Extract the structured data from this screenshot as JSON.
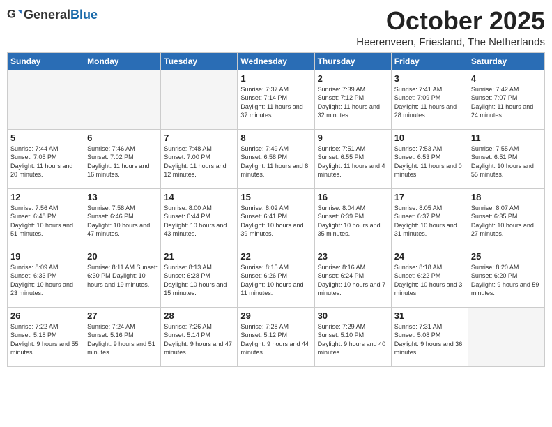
{
  "header": {
    "logo_general": "General",
    "logo_blue": "Blue",
    "title": "October 2025",
    "subtitle": "Heerenveen, Friesland, The Netherlands"
  },
  "columns": [
    "Sunday",
    "Monday",
    "Tuesday",
    "Wednesday",
    "Thursday",
    "Friday",
    "Saturday"
  ],
  "weeks": [
    [
      {
        "day": "",
        "info": ""
      },
      {
        "day": "",
        "info": ""
      },
      {
        "day": "",
        "info": ""
      },
      {
        "day": "1",
        "info": "Sunrise: 7:37 AM\nSunset: 7:14 PM\nDaylight: 11 hours\nand 37 minutes."
      },
      {
        "day": "2",
        "info": "Sunrise: 7:39 AM\nSunset: 7:12 PM\nDaylight: 11 hours\nand 32 minutes."
      },
      {
        "day": "3",
        "info": "Sunrise: 7:41 AM\nSunset: 7:09 PM\nDaylight: 11 hours\nand 28 minutes."
      },
      {
        "day": "4",
        "info": "Sunrise: 7:42 AM\nSunset: 7:07 PM\nDaylight: 11 hours\nand 24 minutes."
      }
    ],
    [
      {
        "day": "5",
        "info": "Sunrise: 7:44 AM\nSunset: 7:05 PM\nDaylight: 11 hours\nand 20 minutes."
      },
      {
        "day": "6",
        "info": "Sunrise: 7:46 AM\nSunset: 7:02 PM\nDaylight: 11 hours\nand 16 minutes."
      },
      {
        "day": "7",
        "info": "Sunrise: 7:48 AM\nSunset: 7:00 PM\nDaylight: 11 hours\nand 12 minutes."
      },
      {
        "day": "8",
        "info": "Sunrise: 7:49 AM\nSunset: 6:58 PM\nDaylight: 11 hours\nand 8 minutes."
      },
      {
        "day": "9",
        "info": "Sunrise: 7:51 AM\nSunset: 6:55 PM\nDaylight: 11 hours\nand 4 minutes."
      },
      {
        "day": "10",
        "info": "Sunrise: 7:53 AM\nSunset: 6:53 PM\nDaylight: 11 hours\nand 0 minutes."
      },
      {
        "day": "11",
        "info": "Sunrise: 7:55 AM\nSunset: 6:51 PM\nDaylight: 10 hours\nand 55 minutes."
      }
    ],
    [
      {
        "day": "12",
        "info": "Sunrise: 7:56 AM\nSunset: 6:48 PM\nDaylight: 10 hours\nand 51 minutes."
      },
      {
        "day": "13",
        "info": "Sunrise: 7:58 AM\nSunset: 6:46 PM\nDaylight: 10 hours\nand 47 minutes."
      },
      {
        "day": "14",
        "info": "Sunrise: 8:00 AM\nSunset: 6:44 PM\nDaylight: 10 hours\nand 43 minutes."
      },
      {
        "day": "15",
        "info": "Sunrise: 8:02 AM\nSunset: 6:41 PM\nDaylight: 10 hours\nand 39 minutes."
      },
      {
        "day": "16",
        "info": "Sunrise: 8:04 AM\nSunset: 6:39 PM\nDaylight: 10 hours\nand 35 minutes."
      },
      {
        "day": "17",
        "info": "Sunrise: 8:05 AM\nSunset: 6:37 PM\nDaylight: 10 hours\nand 31 minutes."
      },
      {
        "day": "18",
        "info": "Sunrise: 8:07 AM\nSunset: 6:35 PM\nDaylight: 10 hours\nand 27 minutes."
      }
    ],
    [
      {
        "day": "19",
        "info": "Sunrise: 8:09 AM\nSunset: 6:33 PM\nDaylight: 10 hours\nand 23 minutes."
      },
      {
        "day": "20",
        "info": "Sunrise: 8:11 AM\nSunset: 6:30 PM\nDaylight: 10 hours\nand 19 minutes."
      },
      {
        "day": "21",
        "info": "Sunrise: 8:13 AM\nSunset: 6:28 PM\nDaylight: 10 hours\nand 15 minutes."
      },
      {
        "day": "22",
        "info": "Sunrise: 8:15 AM\nSunset: 6:26 PM\nDaylight: 10 hours\nand 11 minutes."
      },
      {
        "day": "23",
        "info": "Sunrise: 8:16 AM\nSunset: 6:24 PM\nDaylight: 10 hours\nand 7 minutes."
      },
      {
        "day": "24",
        "info": "Sunrise: 8:18 AM\nSunset: 6:22 PM\nDaylight: 10 hours\nand 3 minutes."
      },
      {
        "day": "25",
        "info": "Sunrise: 8:20 AM\nSunset: 6:20 PM\nDaylight: 9 hours\nand 59 minutes."
      }
    ],
    [
      {
        "day": "26",
        "info": "Sunrise: 7:22 AM\nSunset: 5:18 PM\nDaylight: 9 hours\nand 55 minutes."
      },
      {
        "day": "27",
        "info": "Sunrise: 7:24 AM\nSunset: 5:16 PM\nDaylight: 9 hours\nand 51 minutes."
      },
      {
        "day": "28",
        "info": "Sunrise: 7:26 AM\nSunset: 5:14 PM\nDaylight: 9 hours\nand 47 minutes."
      },
      {
        "day": "29",
        "info": "Sunrise: 7:28 AM\nSunset: 5:12 PM\nDaylight: 9 hours\nand 44 minutes."
      },
      {
        "day": "30",
        "info": "Sunrise: 7:29 AM\nSunset: 5:10 PM\nDaylight: 9 hours\nand 40 minutes."
      },
      {
        "day": "31",
        "info": "Sunrise: 7:31 AM\nSunset: 5:08 PM\nDaylight: 9 hours\nand 36 minutes."
      },
      {
        "day": "",
        "info": ""
      }
    ]
  ]
}
